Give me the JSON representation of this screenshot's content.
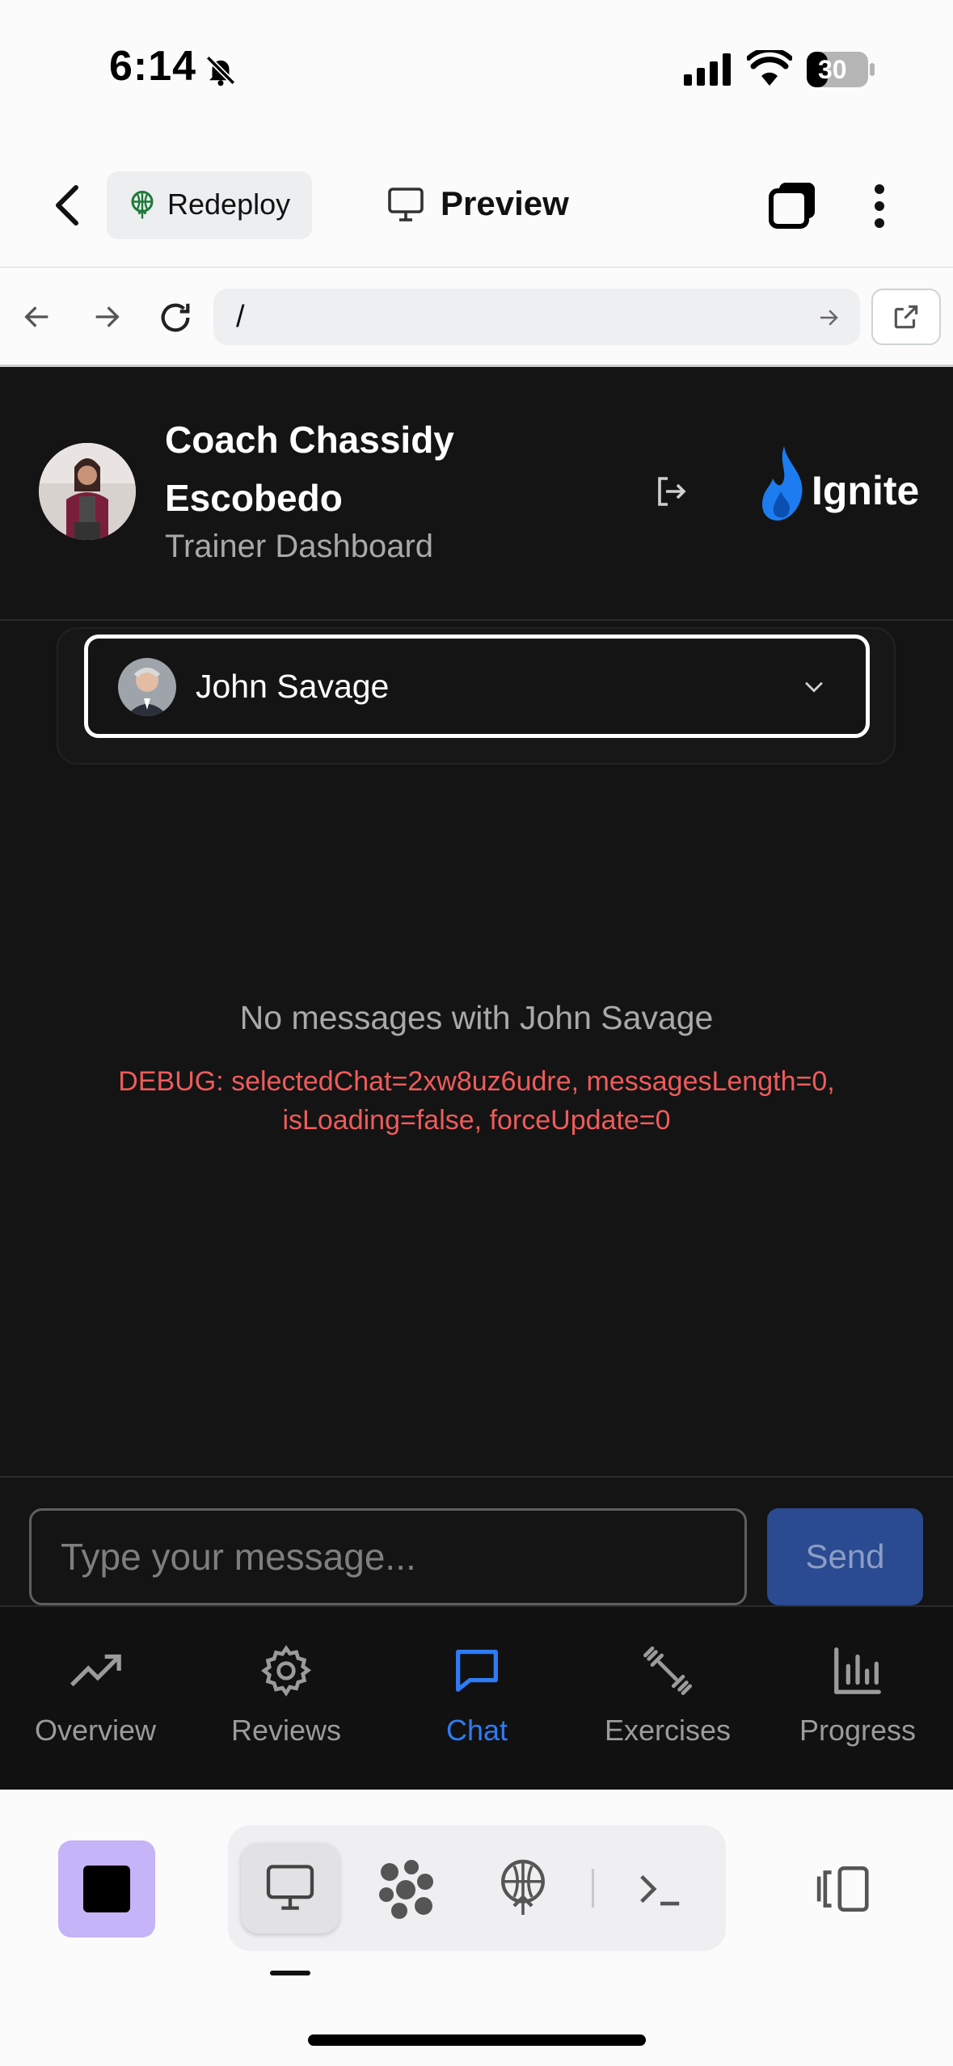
{
  "status_bar": {
    "time": "6:14",
    "battery": "30"
  },
  "app_header": {
    "redeploy_label": "Redeploy",
    "preview_label": "Preview"
  },
  "browser": {
    "url": "/"
  },
  "trainer": {
    "name": "Coach Chassidy Escobedo",
    "subtitle": "Trainer Dashboard",
    "brand": "Ignite"
  },
  "client_selector": {
    "selected": "John Savage"
  },
  "chat": {
    "empty_message": "No messages with John Savage",
    "debug_line1": "DEBUG: selectedChat=2xw8uz6udre, messagesLength=0,",
    "debug_line2": "isLoading=false, forceUpdate=0"
  },
  "composer": {
    "placeholder": "Type your message...",
    "send_label": "Send"
  },
  "nav": {
    "items": [
      {
        "label": "Overview",
        "icon": "trend-up-icon"
      },
      {
        "label": "Reviews",
        "icon": "gear-icon"
      },
      {
        "label": "Chat",
        "icon": "chat-bubble-icon"
      },
      {
        "label": "Exercises",
        "icon": "dumbbell-icon"
      },
      {
        "label": "Progress",
        "icon": "bar-chart-icon"
      }
    ],
    "active": "Chat"
  },
  "colors": {
    "accent": "#2f7bf5",
    "brand": "#1c7cf0",
    "debug": "#ef5b5b",
    "send_bg": "#2a4a91",
    "stop_bg": "#c5b4f7"
  }
}
